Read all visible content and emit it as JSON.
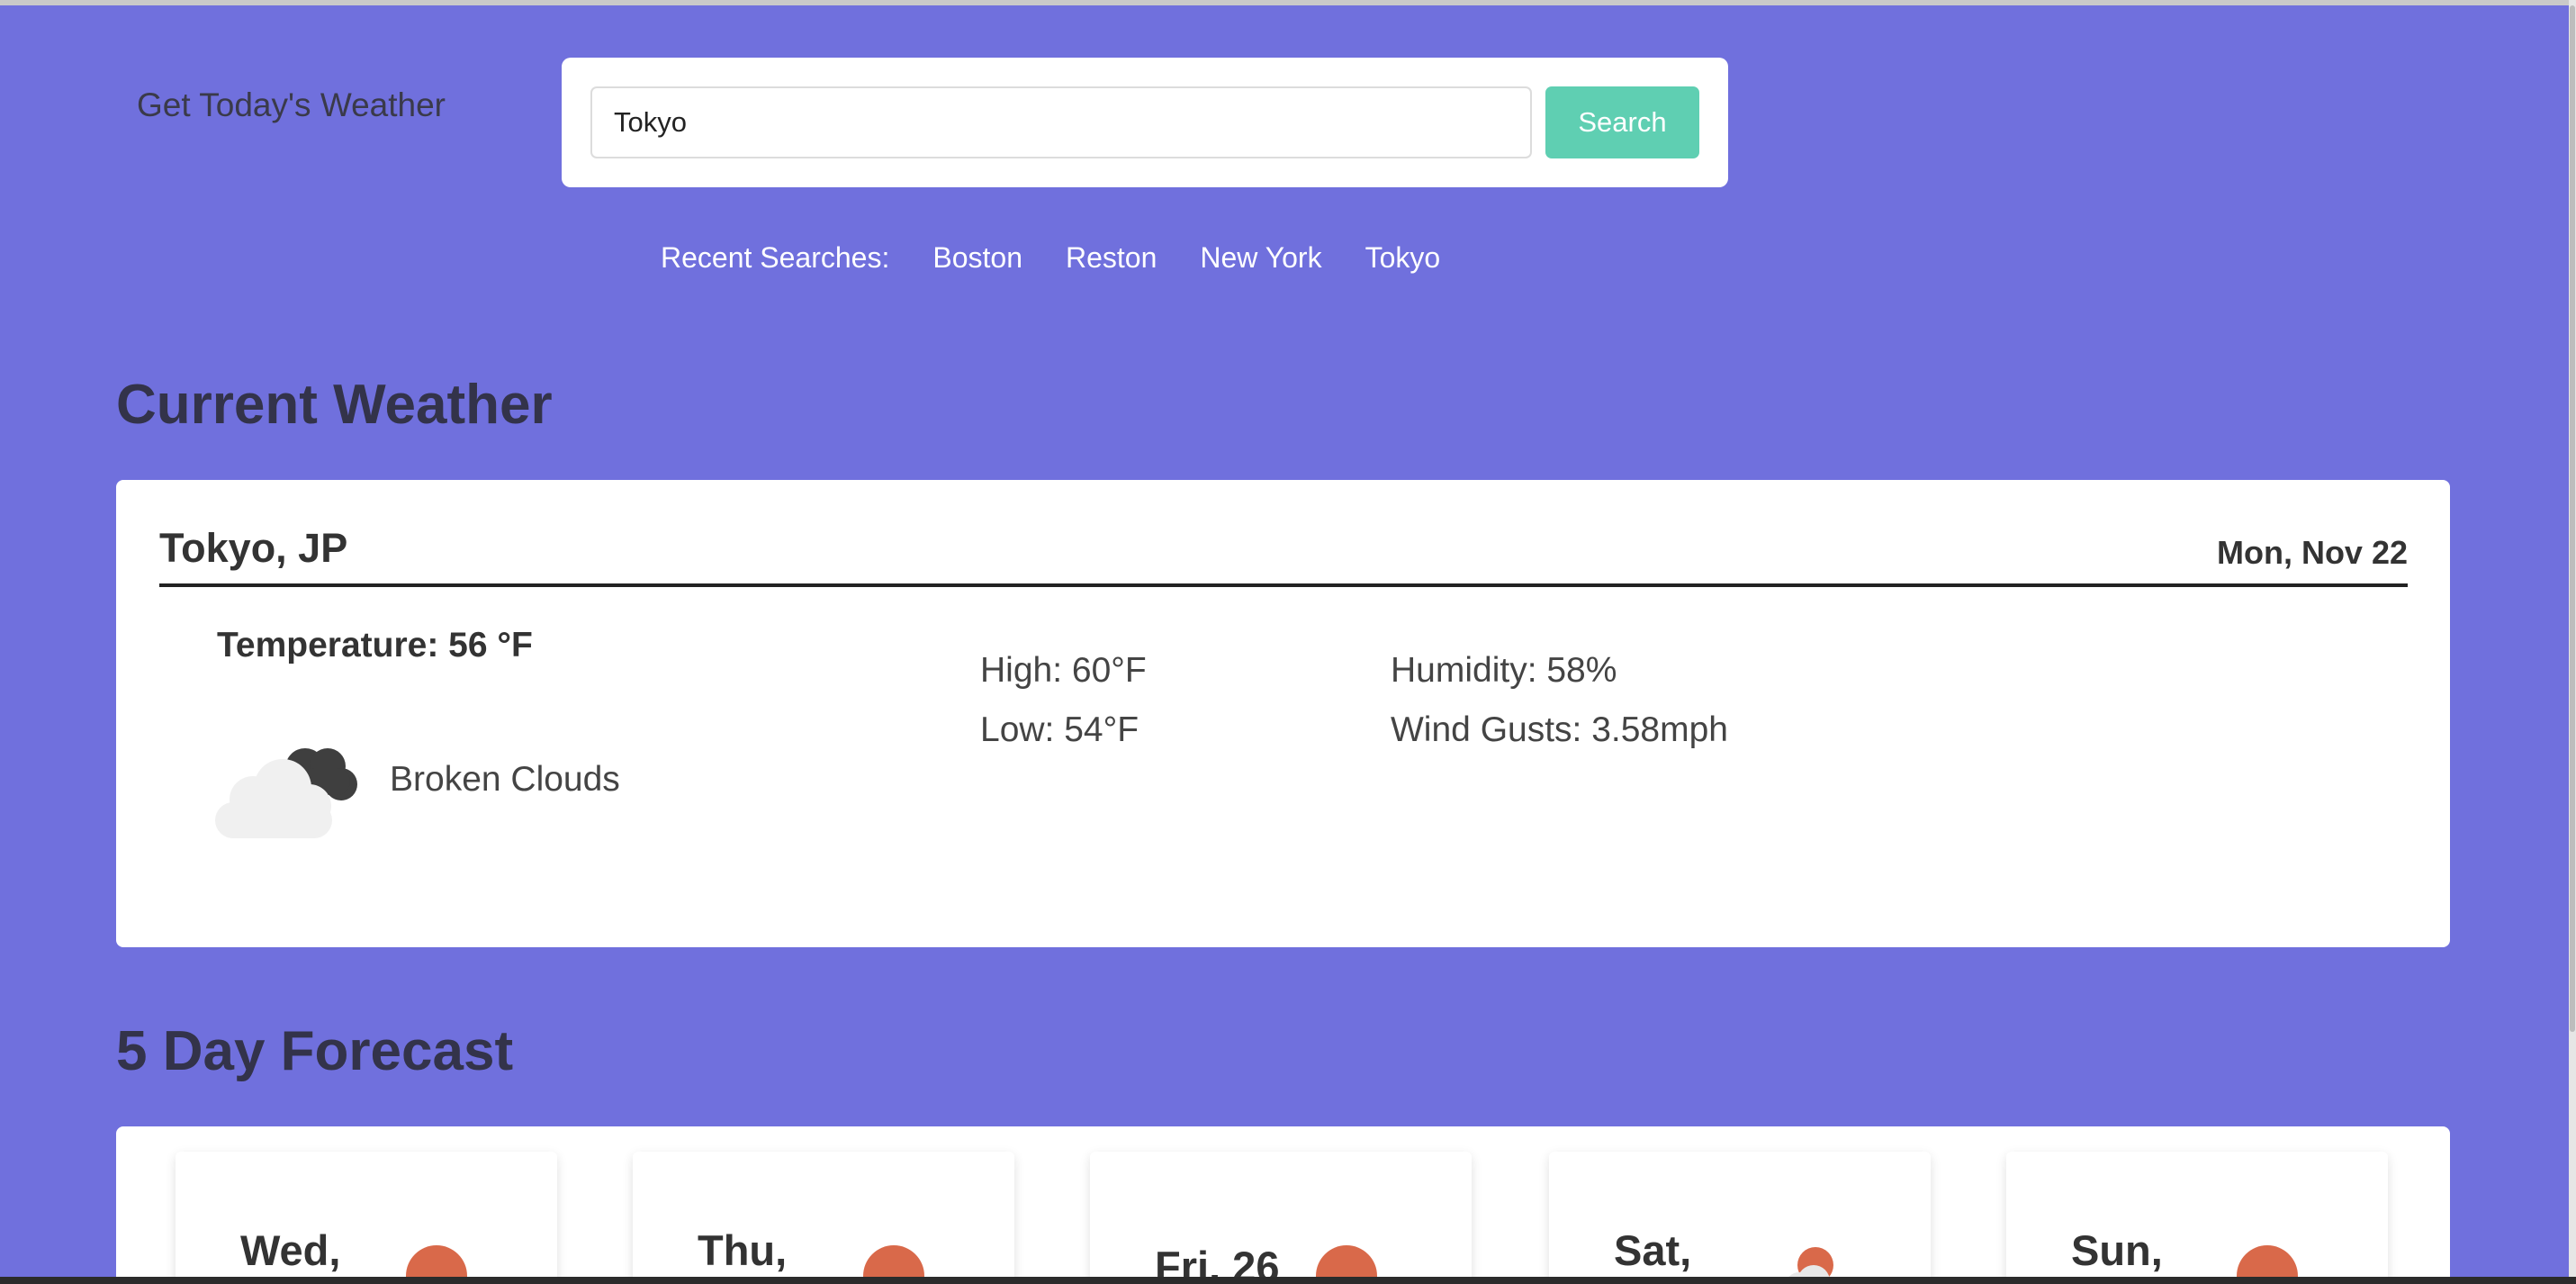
{
  "app": {
    "title": "Get Today's Weather"
  },
  "search": {
    "value": "Tokyo",
    "button_label": "Search"
  },
  "recent": {
    "label": "Recent Searches:",
    "items": [
      "Boston",
      "Reston",
      "New York",
      "Tokyo"
    ]
  },
  "current": {
    "heading": "Current Weather",
    "city": "Tokyo, JP",
    "date": "Mon, Nov 22",
    "temperature": "Temperature: 56 °F",
    "condition": "Broken Clouds",
    "condition_icon": "broken-clouds-icon",
    "high": "High: 60°F",
    "low": "Low: 54°F",
    "humidity": "Humidity: 58%",
    "wind": "Wind Gusts: 3.58mph"
  },
  "forecast": {
    "heading": "5 Day Forecast",
    "days": [
      {
        "label": "Wed,",
        "icon": "sun-icon"
      },
      {
        "label": "Thu,",
        "icon": "sun-icon"
      },
      {
        "label": "Fri, 26",
        "icon": "sun-icon"
      },
      {
        "label": "Sat,",
        "icon": "sun-cloud-icon"
      },
      {
        "label": "Sun,",
        "icon": "sun-icon"
      }
    ]
  },
  "colors": {
    "background": "#7070dd",
    "accent": "#5fcfb2",
    "sun": "#d9694a",
    "text_dark": "#33334a"
  }
}
